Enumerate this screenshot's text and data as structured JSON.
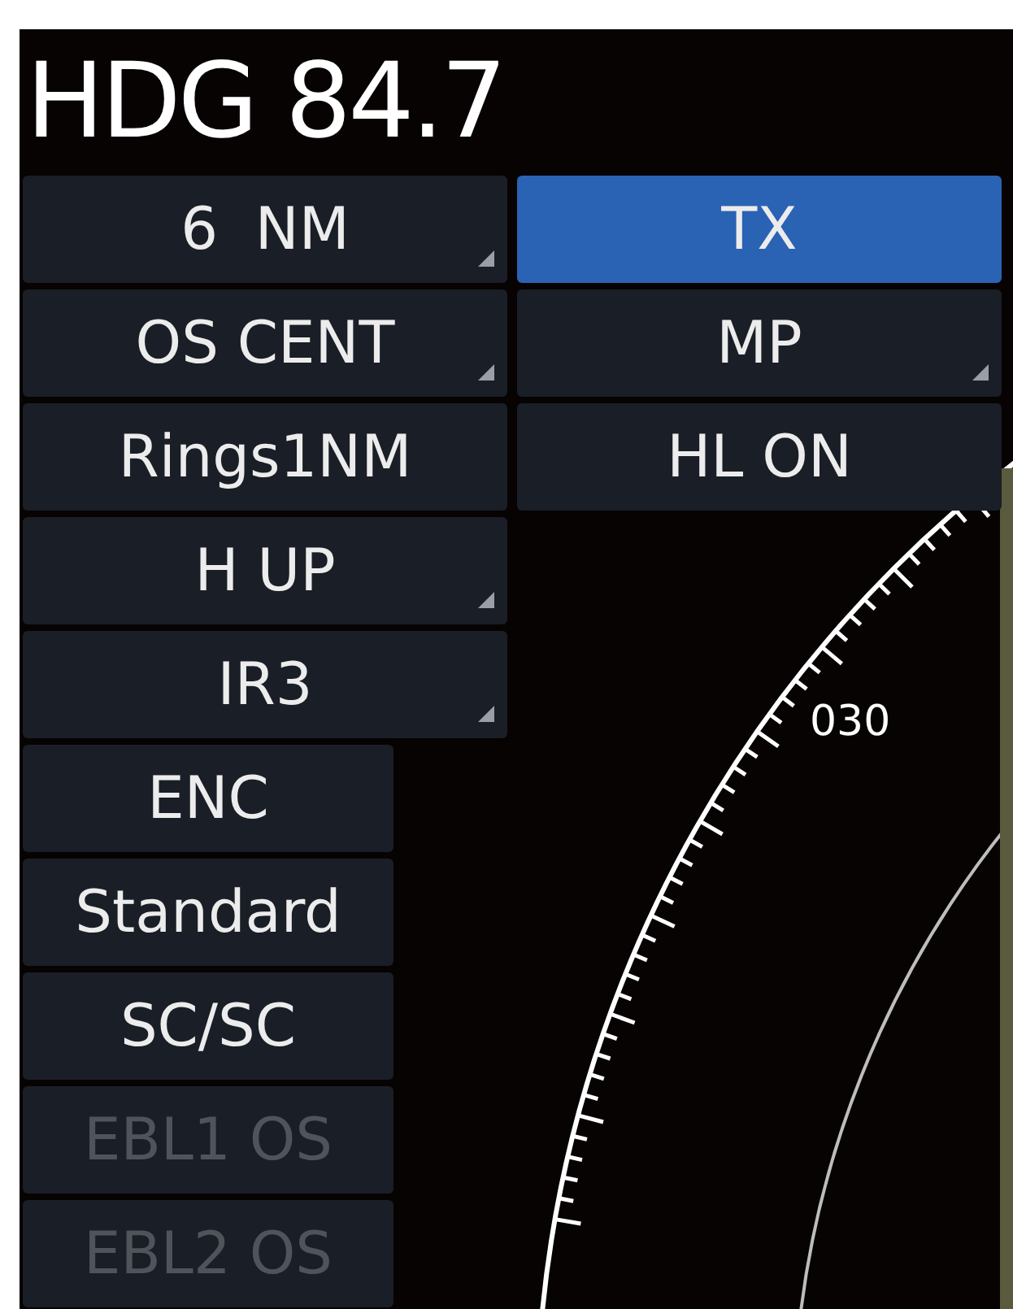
{
  "heading": "HDG 84.7",
  "rows": [
    {
      "buttons": [
        {
          "label": "6  NM",
          "kind": "wide",
          "menu": true,
          "selected": false,
          "disabled": false
        },
        {
          "label": "TX",
          "kind": "wide",
          "menu": false,
          "selected": true,
          "disabled": false
        }
      ]
    },
    {
      "buttons": [
        {
          "label": "OS CENT",
          "kind": "wide",
          "menu": true,
          "selected": false,
          "disabled": false
        },
        {
          "label": "MP",
          "kind": "wide",
          "menu": true,
          "selected": false,
          "disabled": false
        }
      ]
    },
    {
      "buttons": [
        {
          "label": "Rings1NM",
          "kind": "wide",
          "menu": false,
          "selected": false,
          "disabled": false
        },
        {
          "label": "HL ON",
          "kind": "wide",
          "menu": false,
          "selected": false,
          "disabled": false
        }
      ]
    },
    {
      "buttons": [
        {
          "label": "H UP",
          "kind": "wide",
          "menu": true,
          "selected": false,
          "disabled": false
        }
      ]
    },
    {
      "buttons": [
        {
          "label": "IR3",
          "kind": "wide",
          "menu": true,
          "selected": false,
          "disabled": false
        }
      ]
    },
    {
      "buttons": [
        {
          "label": "ENC",
          "kind": "narrow",
          "menu": false,
          "selected": false,
          "disabled": false
        }
      ]
    },
    {
      "buttons": [
        {
          "label": "Standard",
          "kind": "narrow",
          "menu": false,
          "selected": false,
          "disabled": false
        }
      ]
    },
    {
      "buttons": [
        {
          "label": "SC/SC",
          "kind": "narrow",
          "menu": false,
          "selected": false,
          "disabled": false
        }
      ]
    },
    {
      "buttons": [
        {
          "label": "EBL1 OS",
          "kind": "narrow",
          "menu": false,
          "selected": false,
          "disabled": true
        }
      ]
    },
    {
      "buttons": [
        {
          "label": "EBL2 OS",
          "kind": "narrow",
          "menu": false,
          "selected": false,
          "disabled": true
        }
      ]
    }
  ],
  "radar": {
    "bearing_label": "030"
  }
}
